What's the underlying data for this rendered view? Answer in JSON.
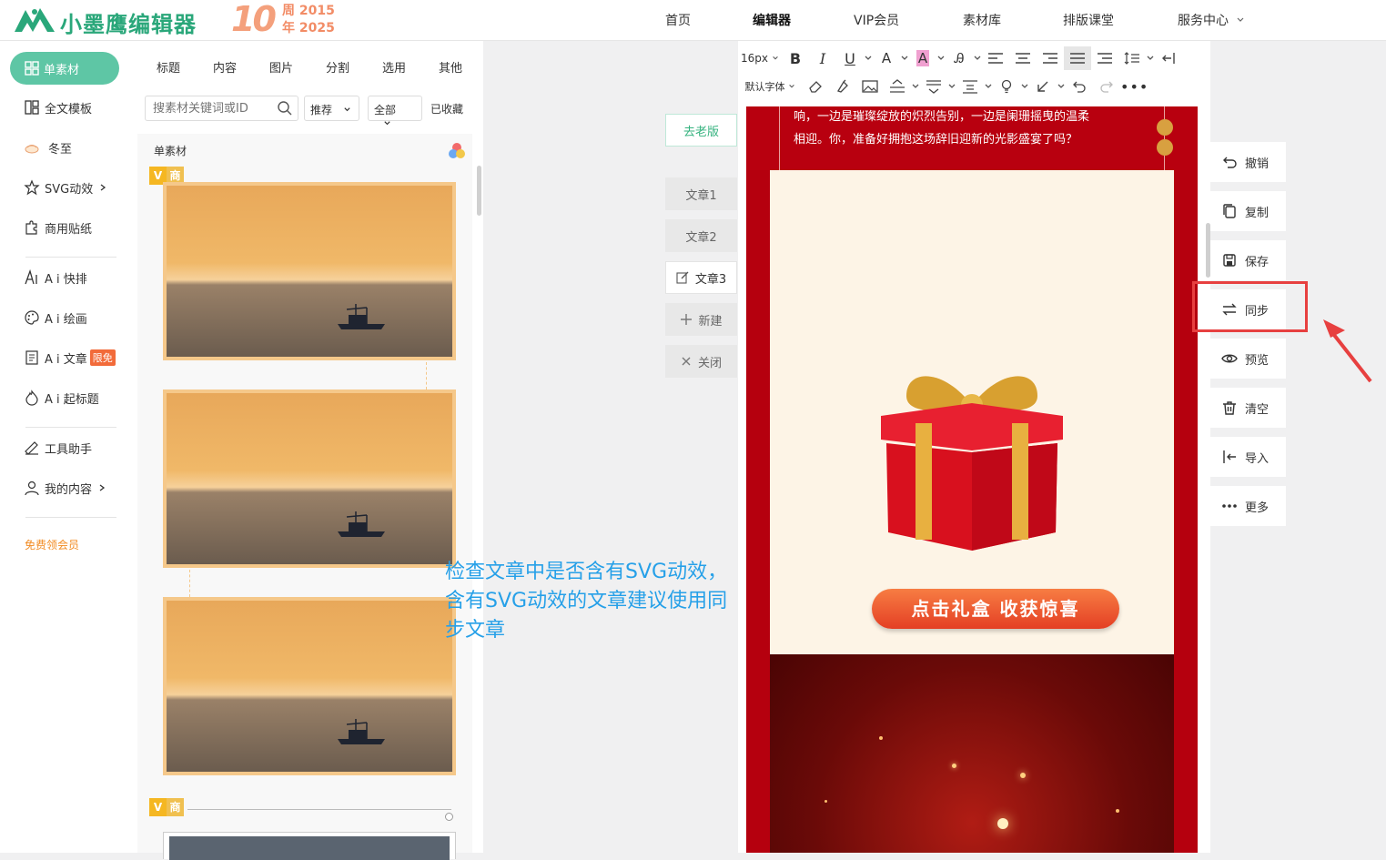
{
  "header": {
    "logo_text": "小墨鹰编辑器",
    "anniversary_ten": "10",
    "anniversary_line1": "周 2015",
    "anniversary_line2": "年 2025",
    "nav": [
      "首页",
      "编辑器",
      "VIP会员",
      "素材库",
      "排版课堂",
      "服务中心"
    ]
  },
  "sidebar": {
    "items": [
      "单素材",
      "全文模板",
      "冬至",
      "SVG动效",
      "商用贴纸",
      "A i 快排",
      "A i 绘画",
      "A i 文章",
      "A i 起标题",
      "工具助手",
      "我的内容"
    ],
    "badge_free": "限免",
    "promo": "免费领会员"
  },
  "materials": {
    "tabs": [
      "标题",
      "内容",
      "图片",
      "分割",
      "选用",
      "其他"
    ],
    "search_placeholder": "搜素材关键词或ID",
    "filter_sort": "推荐",
    "filter_scope": "全部",
    "favorites": "已收藏",
    "section_title": "单素材",
    "badge_v": "V",
    "badge_com": "商"
  },
  "toolbar": {
    "font_size": "16px",
    "font_family": "默认字体"
  },
  "article": {
    "text_line1": "响，一边是璀璨绽放的炽烈告别，一边是阑珊摇曳的温柔",
    "text_line2": "相迎。你，准备好拥抱这场辞旧迎新的光影盛宴了吗？",
    "cta": "点击礼盒 收获惊喜"
  },
  "docs": {
    "old_version": "去老版",
    "list": [
      "文章1",
      "文章2",
      "文章3"
    ],
    "new": "新建",
    "close": "关闭"
  },
  "actions": [
    "撤销",
    "复制",
    "保存",
    "同步",
    "预览",
    "清空",
    "导入",
    "更多"
  ],
  "annotation": {
    "text": "检查文章中是否含有SVG动效，含有SVG动效的文章建议使用同步文章"
  },
  "colors": {
    "brand": "#2aa77a",
    "sidebar_active": "#5ec6a5",
    "highlight": "#e74040",
    "note": "#26a0e8",
    "promo": "#f28c24"
  }
}
